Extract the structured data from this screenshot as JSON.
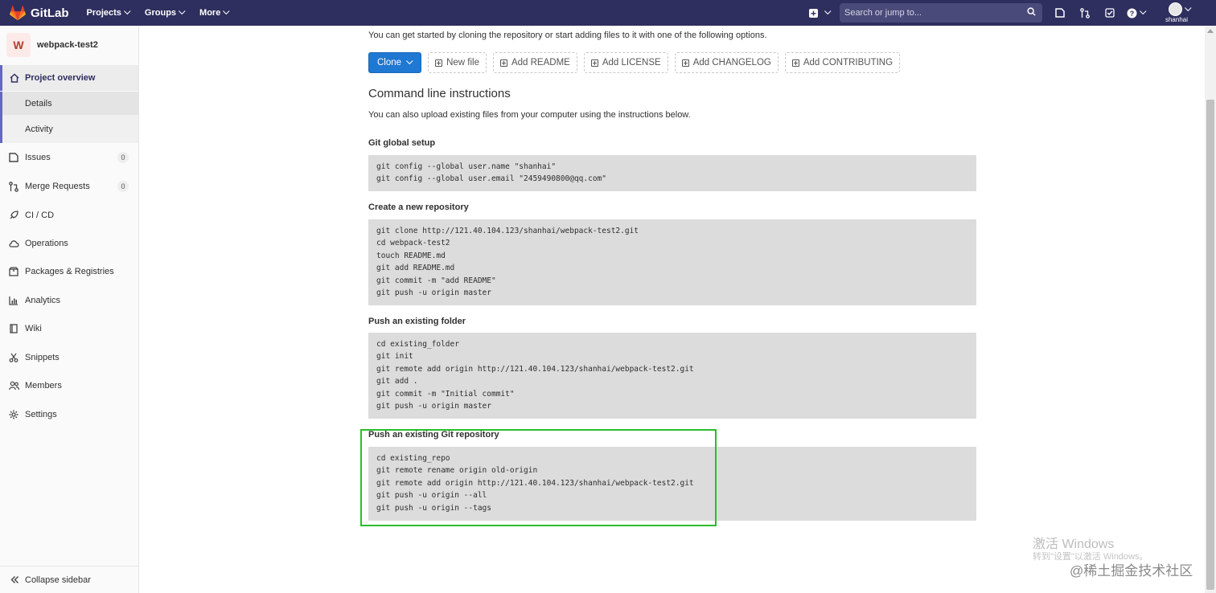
{
  "navbar": {
    "brand": "GitLab",
    "menu": [
      {
        "label": "Projects"
      },
      {
        "label": "Groups"
      },
      {
        "label": "More"
      }
    ],
    "search_placeholder": "Search or jump to...",
    "username": "shanhai"
  },
  "sidebar": {
    "project_initial": "W",
    "project_name": "webpack-test2",
    "overview_label": "Project overview",
    "sub_items": [
      "Details",
      "Activity"
    ],
    "items": [
      {
        "label": "Issues",
        "count": "0",
        "icon": "issues-icon"
      },
      {
        "label": "Merge Requests",
        "count": "0",
        "icon": "merge-request-icon"
      },
      {
        "label": "CI / CD",
        "icon": "rocket-icon"
      },
      {
        "label": "Operations",
        "icon": "cloud-gear-icon"
      },
      {
        "label": "Packages & Registries",
        "icon": "package-icon"
      },
      {
        "label": "Analytics",
        "icon": "chart-icon"
      },
      {
        "label": "Wiki",
        "icon": "book-icon"
      },
      {
        "label": "Snippets",
        "icon": "scissors-icon"
      },
      {
        "label": "Members",
        "icon": "users-icon"
      },
      {
        "label": "Settings",
        "icon": "gear-icon"
      }
    ],
    "collapse_label": "Collapse sidebar"
  },
  "main": {
    "intro": "You can get started by cloning the repository or start adding files to it with one of the following options.",
    "buttons": {
      "clone": "Clone",
      "new_file": "New file",
      "add_readme": "Add README",
      "add_license": "Add LICENSE",
      "add_changelog": "Add CHANGELOG",
      "add_contributing": "Add CONTRIBUTING"
    },
    "cli_title": "Command line instructions",
    "cli_subtitle": "You can also upload existing files from your computer using the instructions below.",
    "sections": [
      {
        "title": "Git global setup",
        "lines": [
          "git config --global user.name \"shanhai\"",
          "git config --global user.email \"2459490800@qq.com\""
        ]
      },
      {
        "title": "Create a new repository",
        "lines": [
          "git clone http://121.40.104.123/shanhai/webpack-test2.git",
          "cd webpack-test2",
          "touch README.md",
          "git add README.md",
          "git commit -m \"add README\"",
          "git push -u origin master"
        ]
      },
      {
        "title": "Push an existing folder",
        "lines": [
          "cd existing_folder",
          "git init",
          "git remote add origin http://121.40.104.123/shanhai/webpack-test2.git",
          "git add .",
          "git commit -m \"Initial commit\"",
          "git push -u origin master"
        ]
      },
      {
        "title": "Push an existing Git repository",
        "lines": [
          "cd existing_repo",
          "git remote rename origin old-origin",
          "git remote add origin http://121.40.104.123/shanhai/webpack-test2.git",
          "git push -u origin --all",
          "git push -u origin --tags"
        ]
      }
    ]
  },
  "overlay": {
    "windows_activate": "激活 Windows",
    "windows_hint": "转到\"设置\"以激活 Windows。",
    "site_watermark": "@稀土掘金技术社区"
  },
  "colors": {
    "navbar": "#2e2e5f",
    "primary_button": "#1f78d1",
    "highlight_box": "#2bbd2b",
    "code_bg": "#dcdcdc"
  }
}
